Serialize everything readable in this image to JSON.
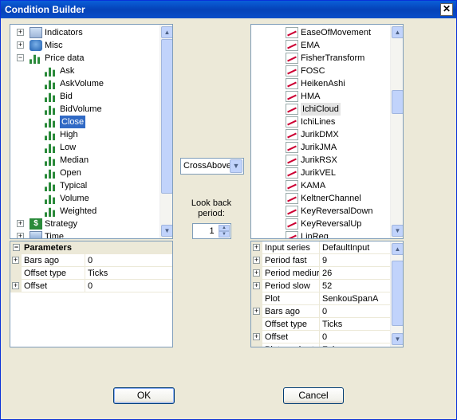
{
  "window": {
    "title": "Condition Builder",
    "close_glyph": "✕"
  },
  "left_tree": {
    "items": [
      {
        "label": "Indicators",
        "expander": "+",
        "icon": "indicators-icon"
      },
      {
        "label": "Misc",
        "expander": "+",
        "icon": "misc-icon"
      },
      {
        "label": "Price data",
        "expander": "−",
        "icon": "price-data-icon"
      },
      {
        "label": "Ask",
        "icon": "bar-chart-icon"
      },
      {
        "label": "AskVolume",
        "icon": "bar-chart-icon"
      },
      {
        "label": "Bid",
        "icon": "bar-chart-icon"
      },
      {
        "label": "BidVolume",
        "icon": "bar-chart-icon"
      },
      {
        "label": "Close",
        "icon": "bar-chart-icon",
        "selected": true
      },
      {
        "label": "High",
        "icon": "bar-chart-icon"
      },
      {
        "label": "Low",
        "icon": "bar-chart-icon"
      },
      {
        "label": "Median",
        "icon": "bar-chart-icon"
      },
      {
        "label": "Open",
        "icon": "bar-chart-icon"
      },
      {
        "label": "Typical",
        "icon": "bar-chart-icon"
      },
      {
        "label": "Volume",
        "icon": "bar-chart-icon"
      },
      {
        "label": "Weighted",
        "icon": "bar-chart-icon"
      },
      {
        "label": "Strategy",
        "expander": "+",
        "icon": "strategy-icon"
      },
      {
        "label": "Time",
        "expander": "+",
        "icon": "time-icon"
      }
    ]
  },
  "right_tree": {
    "items": [
      {
        "label": "EaseOfMovement"
      },
      {
        "label": "EMA"
      },
      {
        "label": "FisherTransform"
      },
      {
        "label": "FOSC"
      },
      {
        "label": "HeikenAshi"
      },
      {
        "label": "HMA"
      },
      {
        "label": "IchiCloud",
        "highlighted": true
      },
      {
        "label": "IchiLines"
      },
      {
        "label": "JurikDMX"
      },
      {
        "label": "JurikJMA"
      },
      {
        "label": "JurikRSX"
      },
      {
        "label": "JurikVEL"
      },
      {
        "label": "KAMA"
      },
      {
        "label": "KeltnerChannel"
      },
      {
        "label": "KeyReversalDown"
      },
      {
        "label": "KeyReversalUp"
      },
      {
        "label": "LinReg"
      }
    ]
  },
  "left_params": {
    "header": "Parameters",
    "header_expander": "−",
    "rows": [
      {
        "expander": "+",
        "name": "Bars ago",
        "value": "0"
      },
      {
        "expander": "",
        "name": "Offset type",
        "value": "Ticks"
      },
      {
        "expander": "+",
        "name": "Offset",
        "value": "0"
      }
    ]
  },
  "right_params": {
    "rows": [
      {
        "expander": "+",
        "name": "Input series",
        "value": "DefaultInput"
      },
      {
        "expander": "+",
        "name": "Period fast",
        "value": "9"
      },
      {
        "expander": "+",
        "name": "Period mediur",
        "value": "26"
      },
      {
        "expander": "+",
        "name": "Period slow",
        "value": "52"
      },
      {
        "expander": "",
        "name": "Plot",
        "value": "SenkouSpanA"
      },
      {
        "expander": "+",
        "name": "Bars ago",
        "value": "0"
      },
      {
        "expander": "",
        "name": "Offset type",
        "value": "Ticks"
      },
      {
        "expander": "+",
        "name": "Offset",
        "value": "0"
      },
      {
        "expander": "",
        "name": "Plot on chart",
        "value": "False"
      }
    ]
  },
  "operator": {
    "value": "CrossAbove",
    "dropdown_glyph": "▼"
  },
  "lookback": {
    "label": "Look back period:",
    "value": "1",
    "up_glyph": "▲",
    "down_glyph": "▼"
  },
  "buttons": {
    "ok": "OK",
    "cancel": "Cancel"
  },
  "scroll_glyphs": {
    "up": "▲",
    "down": "▼"
  }
}
